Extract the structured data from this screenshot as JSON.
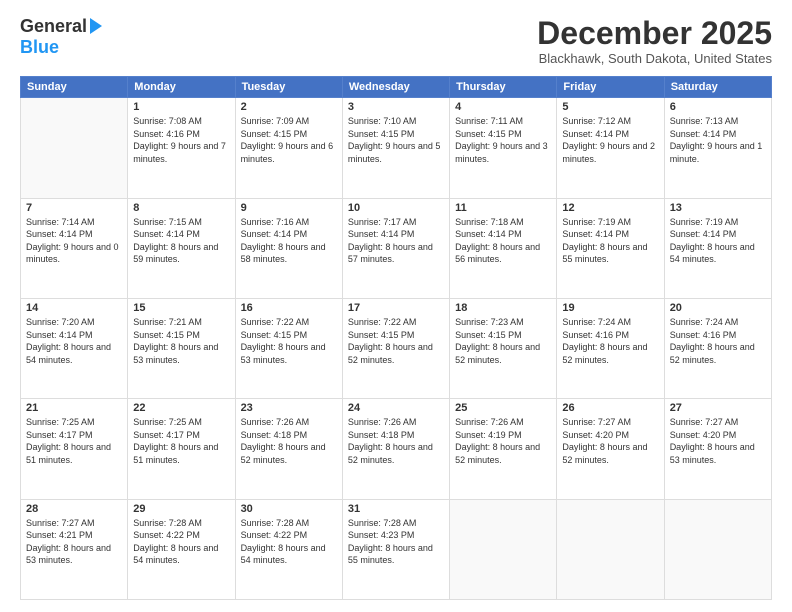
{
  "logo": {
    "line1": "General",
    "line2": "Blue"
  },
  "title": "December 2025",
  "location": "Blackhawk, South Dakota, United States",
  "weekdays": [
    "Sunday",
    "Monday",
    "Tuesday",
    "Wednesday",
    "Thursday",
    "Friday",
    "Saturday"
  ],
  "weeks": [
    [
      {
        "day": "",
        "sunrise": "",
        "sunset": "",
        "daylight": ""
      },
      {
        "day": "1",
        "sunrise": "Sunrise: 7:08 AM",
        "sunset": "Sunset: 4:16 PM",
        "daylight": "Daylight: 9 hours and 7 minutes."
      },
      {
        "day": "2",
        "sunrise": "Sunrise: 7:09 AM",
        "sunset": "Sunset: 4:15 PM",
        "daylight": "Daylight: 9 hours and 6 minutes."
      },
      {
        "day": "3",
        "sunrise": "Sunrise: 7:10 AM",
        "sunset": "Sunset: 4:15 PM",
        "daylight": "Daylight: 9 hours and 5 minutes."
      },
      {
        "day": "4",
        "sunrise": "Sunrise: 7:11 AM",
        "sunset": "Sunset: 4:15 PM",
        "daylight": "Daylight: 9 hours and 3 minutes."
      },
      {
        "day": "5",
        "sunrise": "Sunrise: 7:12 AM",
        "sunset": "Sunset: 4:14 PM",
        "daylight": "Daylight: 9 hours and 2 minutes."
      },
      {
        "day": "6",
        "sunrise": "Sunrise: 7:13 AM",
        "sunset": "Sunset: 4:14 PM",
        "daylight": "Daylight: 9 hours and 1 minute."
      }
    ],
    [
      {
        "day": "7",
        "sunrise": "Sunrise: 7:14 AM",
        "sunset": "Sunset: 4:14 PM",
        "daylight": "Daylight: 9 hours and 0 minutes."
      },
      {
        "day": "8",
        "sunrise": "Sunrise: 7:15 AM",
        "sunset": "Sunset: 4:14 PM",
        "daylight": "Daylight: 8 hours and 59 minutes."
      },
      {
        "day": "9",
        "sunrise": "Sunrise: 7:16 AM",
        "sunset": "Sunset: 4:14 PM",
        "daylight": "Daylight: 8 hours and 58 minutes."
      },
      {
        "day": "10",
        "sunrise": "Sunrise: 7:17 AM",
        "sunset": "Sunset: 4:14 PM",
        "daylight": "Daylight: 8 hours and 57 minutes."
      },
      {
        "day": "11",
        "sunrise": "Sunrise: 7:18 AM",
        "sunset": "Sunset: 4:14 PM",
        "daylight": "Daylight: 8 hours and 56 minutes."
      },
      {
        "day": "12",
        "sunrise": "Sunrise: 7:19 AM",
        "sunset": "Sunset: 4:14 PM",
        "daylight": "Daylight: 8 hours and 55 minutes."
      },
      {
        "day": "13",
        "sunrise": "Sunrise: 7:19 AM",
        "sunset": "Sunset: 4:14 PM",
        "daylight": "Daylight: 8 hours and 54 minutes."
      }
    ],
    [
      {
        "day": "14",
        "sunrise": "Sunrise: 7:20 AM",
        "sunset": "Sunset: 4:14 PM",
        "daylight": "Daylight: 8 hours and 54 minutes."
      },
      {
        "day": "15",
        "sunrise": "Sunrise: 7:21 AM",
        "sunset": "Sunset: 4:15 PM",
        "daylight": "Daylight: 8 hours and 53 minutes."
      },
      {
        "day": "16",
        "sunrise": "Sunrise: 7:22 AM",
        "sunset": "Sunset: 4:15 PM",
        "daylight": "Daylight: 8 hours and 53 minutes."
      },
      {
        "day": "17",
        "sunrise": "Sunrise: 7:22 AM",
        "sunset": "Sunset: 4:15 PM",
        "daylight": "Daylight: 8 hours and 52 minutes."
      },
      {
        "day": "18",
        "sunrise": "Sunrise: 7:23 AM",
        "sunset": "Sunset: 4:15 PM",
        "daylight": "Daylight: 8 hours and 52 minutes."
      },
      {
        "day": "19",
        "sunrise": "Sunrise: 7:24 AM",
        "sunset": "Sunset: 4:16 PM",
        "daylight": "Daylight: 8 hours and 52 minutes."
      },
      {
        "day": "20",
        "sunrise": "Sunrise: 7:24 AM",
        "sunset": "Sunset: 4:16 PM",
        "daylight": "Daylight: 8 hours and 52 minutes."
      }
    ],
    [
      {
        "day": "21",
        "sunrise": "Sunrise: 7:25 AM",
        "sunset": "Sunset: 4:17 PM",
        "daylight": "Daylight: 8 hours and 51 minutes."
      },
      {
        "day": "22",
        "sunrise": "Sunrise: 7:25 AM",
        "sunset": "Sunset: 4:17 PM",
        "daylight": "Daylight: 8 hours and 51 minutes."
      },
      {
        "day": "23",
        "sunrise": "Sunrise: 7:26 AM",
        "sunset": "Sunset: 4:18 PM",
        "daylight": "Daylight: 8 hours and 52 minutes."
      },
      {
        "day": "24",
        "sunrise": "Sunrise: 7:26 AM",
        "sunset": "Sunset: 4:18 PM",
        "daylight": "Daylight: 8 hours and 52 minutes."
      },
      {
        "day": "25",
        "sunrise": "Sunrise: 7:26 AM",
        "sunset": "Sunset: 4:19 PM",
        "daylight": "Daylight: 8 hours and 52 minutes."
      },
      {
        "day": "26",
        "sunrise": "Sunrise: 7:27 AM",
        "sunset": "Sunset: 4:20 PM",
        "daylight": "Daylight: 8 hours and 52 minutes."
      },
      {
        "day": "27",
        "sunrise": "Sunrise: 7:27 AM",
        "sunset": "Sunset: 4:20 PM",
        "daylight": "Daylight: 8 hours and 53 minutes."
      }
    ],
    [
      {
        "day": "28",
        "sunrise": "Sunrise: 7:27 AM",
        "sunset": "Sunset: 4:21 PM",
        "daylight": "Daylight: 8 hours and 53 minutes."
      },
      {
        "day": "29",
        "sunrise": "Sunrise: 7:28 AM",
        "sunset": "Sunset: 4:22 PM",
        "daylight": "Daylight: 8 hours and 54 minutes."
      },
      {
        "day": "30",
        "sunrise": "Sunrise: 7:28 AM",
        "sunset": "Sunset: 4:22 PM",
        "daylight": "Daylight: 8 hours and 54 minutes."
      },
      {
        "day": "31",
        "sunrise": "Sunrise: 7:28 AM",
        "sunset": "Sunset: 4:23 PM",
        "daylight": "Daylight: 8 hours and 55 minutes."
      },
      {
        "day": "",
        "sunrise": "",
        "sunset": "",
        "daylight": ""
      },
      {
        "day": "",
        "sunrise": "",
        "sunset": "",
        "daylight": ""
      },
      {
        "day": "",
        "sunrise": "",
        "sunset": "",
        "daylight": ""
      }
    ]
  ]
}
